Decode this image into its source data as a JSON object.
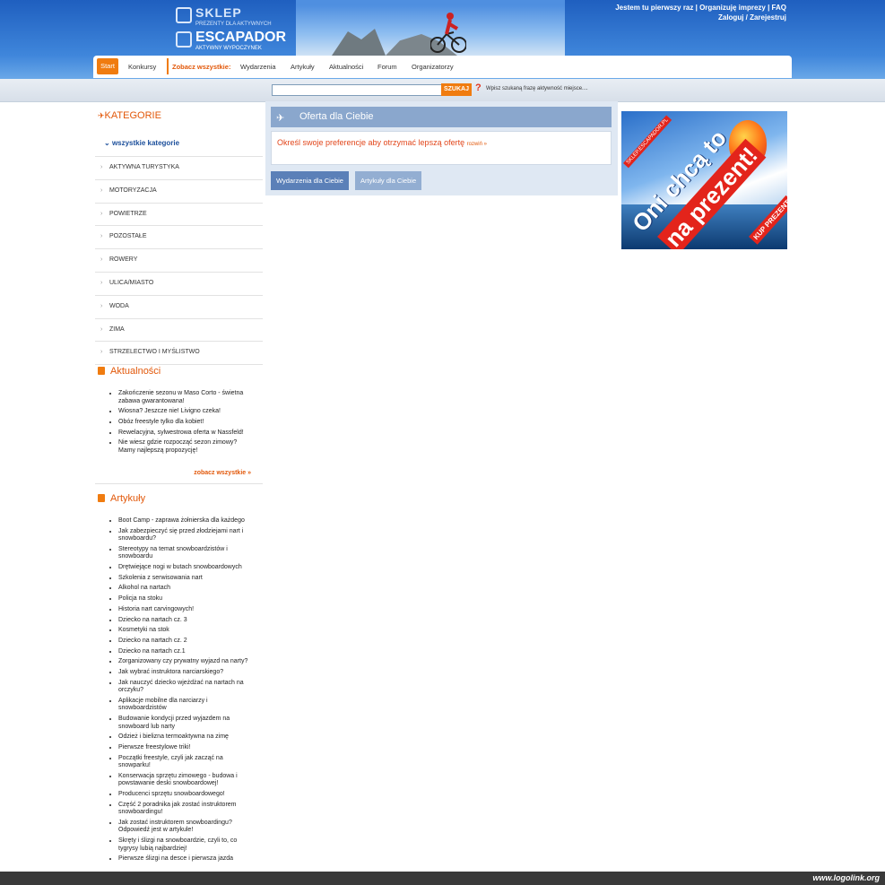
{
  "header": {
    "logo_shop_title": "SKLEP",
    "logo_shop_subtitle": "PREZENTY DLA AKTYWNYCH",
    "logo_main_title": "ESCAPADOR",
    "logo_main_subtitle": "AKTYWNY WYPOCZYNEK",
    "top_links_line1": "Jestem tu pierwszy raz | Organizuję imprezy | FAQ",
    "top_links_line2": "Zaloguj / Zarejestruj"
  },
  "nav": {
    "start": "Start",
    "konkursy": "Konkursy",
    "see_all": "Zobacz wszystkie:",
    "items": [
      "Wydarzenia",
      "Artykuły",
      "Aktualności",
      "Forum",
      "Organizatorzy"
    ]
  },
  "search": {
    "value": "",
    "button": "SZUKAJ",
    "help_icon": "?",
    "hint": "Wpisz szukaną frazę aktywność miejsce...."
  },
  "sidebar": {
    "categories_title": "KATEGORIE",
    "all_categories": "wszystkie kategorie",
    "categories": [
      "AKTYWNA TURYSTYKA",
      "MOTORYZACJA",
      "POWIETRZE",
      "POZOSTAŁE",
      "ROWERY",
      "ULICA/MIASTO",
      "WODA",
      "ZIMA",
      "STRZELECTWO I MYŚLISTWO"
    ],
    "news_title": "Aktualności",
    "news": [
      "Zakończenie sezonu w Maso Corto - świetna zabawa gwarantowana!",
      "Wiosna? Jeszcze nie! Livigno czeka!",
      "Obóz freestyle tylko dla kobiet!",
      "Rewelacyjna, sylwestrowa oferta w Nassfeld!",
      "Nie wiesz gdzie rozpocząć sezon zimowy? Mamy najlepszą propozycję!"
    ],
    "news_more": "zobacz wszystkie »",
    "articles_title": "Artykuły",
    "articles": [
      "Boot Camp - zaprawa żołnierska dla każdego",
      "Jak zabezpieczyć się przed złodziejami nart i snowboardu?",
      "Stereotypy na temat snowboardzistów i snowboardu",
      "Drętwiejące nogi w butach snowboardowych",
      "Szkolenia z serwisowania nart",
      "Alkohol na nartach",
      "Policja na stoku",
      "Historia nart carvingowych!",
      "Dziecko na nartach cz. 3",
      "Kosmetyki na stok",
      "Dziecko na nartach cz. 2",
      "Dziecko na nartach cz.1",
      "Zorganizowany czy prywatny wyjazd na narty?",
      "Jak wybrać instruktora narciarskiego?",
      "Jak nauczyć dziecko wjeżdżać na nartach na orczyku?",
      "Aplikacje mobilne dla narciarzy i snowboardzistów",
      "Budowanie kondycji przed wyjazdem na snowboard lub narty",
      "Odzież i bielizna termoaktywna na zimę",
      "Pierwsze freestylowe triki!",
      "Początki freestyle, czyli jak zacząć na snowparku!",
      "Konserwacja sprzętu zimowego - budowa i powstawanie deski snowboardowej!",
      "Producenci sprzętu snowboardowego!",
      "Część 2 poradnika jak zostać instruktorem snowboardingu!",
      "Jak zostać instruktorem snowboardingu? Odpowiedź jest w artykule!",
      "Skręty i ślizgi na snowboardzie, czyli to, co tygrysy lubią najbardziej!",
      "Pierwsze ślizgi na desce i pierwsza jazda"
    ]
  },
  "offer": {
    "title": "Oferta dla Ciebie",
    "text": "Określ swoje preferencje aby otrzymać lepszą ofertę",
    "more": "rozwiń »",
    "tab_events": "Wydarzenia dla Ciebie",
    "tab_articles": "Artykuły dla Ciebie"
  },
  "banner": {
    "shop": "SKLEP.ESCAPADOR.PL",
    "line1": "Oni chcą to",
    "line2": "na prezent!",
    "buy": "KUP PREZENT"
  },
  "footer": {
    "watermark": "www.logolink.org"
  },
  "colors": {
    "accent": "#f07c10",
    "header_blue": "#3f86db",
    "link_blue": "#1c4f9b",
    "offer_red": "#e2471c"
  }
}
